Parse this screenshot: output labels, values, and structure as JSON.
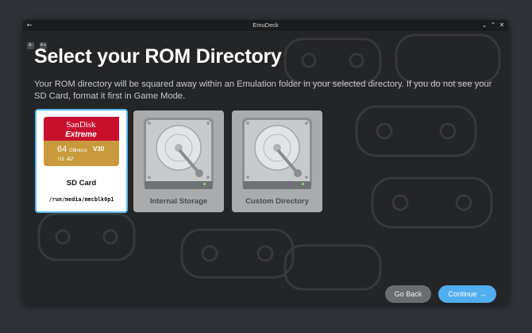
{
  "window": {
    "title": "EmuDeck",
    "back_glyph": "←",
    "minimize_glyph": "⌄",
    "maximize_glyph": "⌃",
    "close_glyph": "✕"
  },
  "font_controls": [
    "A-",
    "A+"
  ],
  "page": {
    "heading": "Select your ROM Directory",
    "description": "Your ROM directory will be squared away within an Emulation folder in your selected directory. If you do not see your SD Card, format it first in Game Mode."
  },
  "cards": {
    "sd": {
      "label": "SD Card",
      "path": "/run/media/mmcblk0p1",
      "brand": "SanDisk",
      "product": "Extreme",
      "capacity": "64",
      "capacity_unit": "GB",
      "rating": "V30",
      "class": "A2",
      "selected": true
    },
    "internal": {
      "label": "Internal Storage"
    },
    "custom": {
      "label": "Custom Directory"
    }
  },
  "buttons": {
    "back": "Go Back",
    "continue": "Continue",
    "continue_icon": "→"
  },
  "colors": {
    "accent": "#52aef0",
    "selected_border": "#5ab6f2",
    "sd_red": "#c8102e",
    "sd_gold": "#c89a3c"
  }
}
